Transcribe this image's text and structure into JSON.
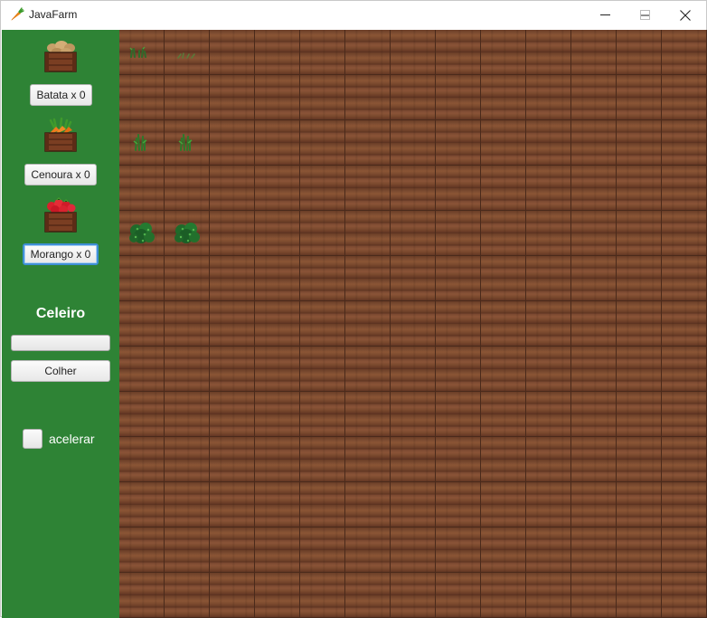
{
  "window": {
    "title": "JavaFarm",
    "icon": "carrot-icon",
    "controls": [
      "minimize-icon",
      "maximize-icon",
      "close-icon"
    ]
  },
  "sidebar": {
    "background": "#2e8335",
    "seeds": [
      {
        "name": "batata",
        "crate_icon": "potato-crate-icon",
        "label": "Batata x 0"
      },
      {
        "name": "cenoura",
        "crate_icon": "carrot-crate-icon",
        "label": "Cenoura x 0"
      },
      {
        "name": "morango",
        "crate_icon": "strawberry-crate-icon",
        "label": "Morango x 0",
        "focused": true
      }
    ],
    "celeiro": {
      "title": "Celeiro",
      "progress": 0,
      "harvest_label": "Colher"
    },
    "accelerate": {
      "label": "acelerar",
      "checked": false
    }
  },
  "farm": {
    "rows": 13,
    "cols": 13,
    "planted": [
      {
        "row": 0,
        "col": 0,
        "crop": "potato-sprout-icon"
      },
      {
        "row": 0,
        "col": 1,
        "crop": "potato-seedling-icon"
      },
      {
        "row": 2,
        "col": 0,
        "crop": "carrot-sprout-icon"
      },
      {
        "row": 2,
        "col": 1,
        "crop": "carrot-sprout-icon"
      },
      {
        "row": 4,
        "col": 0,
        "crop": "strawberry-bush-icon"
      },
      {
        "row": 4,
        "col": 1,
        "crop": "strawberry-bush-icon"
      }
    ]
  }
}
